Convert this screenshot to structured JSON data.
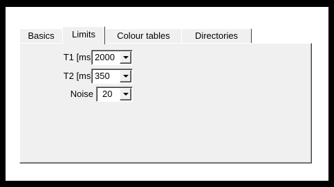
{
  "tabs": [
    {
      "label": "Basics"
    },
    {
      "label": "Limits"
    },
    {
      "label": "Colour tables"
    },
    {
      "label": "Directories"
    }
  ],
  "selected_tab": "Limits",
  "fields": {
    "t1": {
      "label": "T1 [ms]",
      "value": "2000"
    },
    "t2": {
      "label": "T2 [ms]",
      "value": "350"
    },
    "noise": {
      "label": "Noise",
      "value": "20"
    }
  },
  "icons": {
    "dropdown": "chevron-down-icon"
  },
  "colors": {
    "frame": "#000000",
    "window": "#ffffff",
    "panel": "#f0f0f0"
  }
}
